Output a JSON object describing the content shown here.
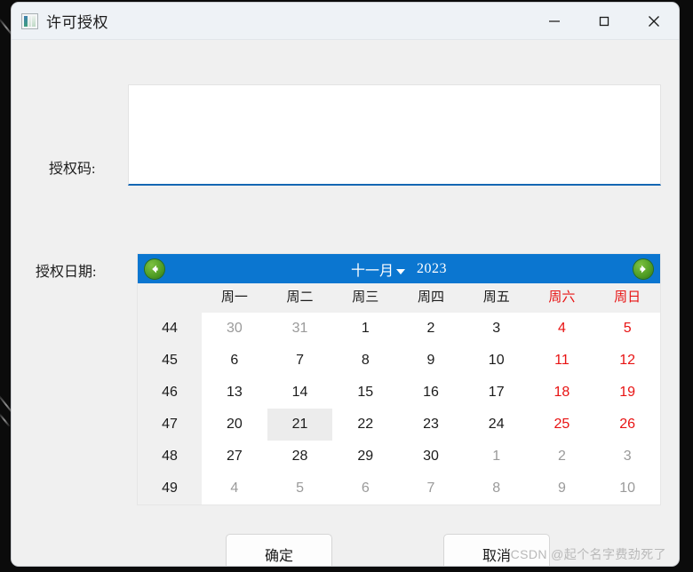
{
  "window": {
    "title": "许可授权",
    "icon": "app-image-icon",
    "controls": [
      {
        "name": "minimize-button",
        "glyph": "minimize-icon"
      },
      {
        "name": "maximize-button",
        "glyph": "maximize-icon"
      },
      {
        "name": "close-button",
        "glyph": "close-icon"
      }
    ]
  },
  "form": {
    "code_label": "授权码:",
    "code_value": "",
    "code_placeholder": "",
    "date_label": "授权日期:"
  },
  "calendar": {
    "prev_icon": "arrow-left-circle-icon",
    "next_icon": "arrow-right-circle-icon",
    "month": "十一月",
    "year": "2023",
    "dropdown_icon": "chevron-down-icon",
    "weekday_header_label": "",
    "weekdays": [
      "周一",
      "周二",
      "周三",
      "周四",
      "周五",
      "周六",
      "周日"
    ],
    "weekend_indices": [
      5,
      6
    ],
    "weekend_color": "#e81313",
    "header_bg": "#0b76d0",
    "selected_day": 21,
    "weeks": [
      {
        "week_number": "44",
        "days": [
          {
            "label": "30",
            "muted": true,
            "weekend": false
          },
          {
            "label": "31",
            "muted": true,
            "weekend": false
          },
          {
            "label": "1",
            "muted": false,
            "weekend": false
          },
          {
            "label": "2",
            "muted": false,
            "weekend": false
          },
          {
            "label": "3",
            "muted": false,
            "weekend": false
          },
          {
            "label": "4",
            "muted": false,
            "weekend": true
          },
          {
            "label": "5",
            "muted": false,
            "weekend": true
          }
        ]
      },
      {
        "week_number": "45",
        "days": [
          {
            "label": "6",
            "muted": false,
            "weekend": false
          },
          {
            "label": "7",
            "muted": false,
            "weekend": false
          },
          {
            "label": "8",
            "muted": false,
            "weekend": false
          },
          {
            "label": "9",
            "muted": false,
            "weekend": false
          },
          {
            "label": "10",
            "muted": false,
            "weekend": false
          },
          {
            "label": "11",
            "muted": false,
            "weekend": true
          },
          {
            "label": "12",
            "muted": false,
            "weekend": true
          }
        ]
      },
      {
        "week_number": "46",
        "days": [
          {
            "label": "13",
            "muted": false,
            "weekend": false
          },
          {
            "label": "14",
            "muted": false,
            "weekend": false
          },
          {
            "label": "15",
            "muted": false,
            "weekend": false
          },
          {
            "label": "16",
            "muted": false,
            "weekend": false
          },
          {
            "label": "17",
            "muted": false,
            "weekend": false
          },
          {
            "label": "18",
            "muted": false,
            "weekend": true
          },
          {
            "label": "19",
            "muted": false,
            "weekend": true
          }
        ]
      },
      {
        "week_number": "47",
        "days": [
          {
            "label": "20",
            "muted": false,
            "weekend": false
          },
          {
            "label": "21",
            "muted": false,
            "weekend": false,
            "today": true
          },
          {
            "label": "22",
            "muted": false,
            "weekend": false
          },
          {
            "label": "23",
            "muted": false,
            "weekend": false
          },
          {
            "label": "24",
            "muted": false,
            "weekend": false
          },
          {
            "label": "25",
            "muted": false,
            "weekend": true
          },
          {
            "label": "26",
            "muted": false,
            "weekend": true
          }
        ]
      },
      {
        "week_number": "48",
        "days": [
          {
            "label": "27",
            "muted": false,
            "weekend": false
          },
          {
            "label": "28",
            "muted": false,
            "weekend": false
          },
          {
            "label": "29",
            "muted": false,
            "weekend": false
          },
          {
            "label": "30",
            "muted": false,
            "weekend": false
          },
          {
            "label": "1",
            "muted": true,
            "weekend": false
          },
          {
            "label": "2",
            "muted": true,
            "weekend": true
          },
          {
            "label": "3",
            "muted": true,
            "weekend": true
          }
        ]
      },
      {
        "week_number": "49",
        "days": [
          {
            "label": "4",
            "muted": true,
            "weekend": false
          },
          {
            "label": "5",
            "muted": true,
            "weekend": false
          },
          {
            "label": "6",
            "muted": true,
            "weekend": false
          },
          {
            "label": "7",
            "muted": true,
            "weekend": false
          },
          {
            "label": "8",
            "muted": true,
            "weekend": false
          },
          {
            "label": "9",
            "muted": true,
            "weekend": true
          },
          {
            "label": "10",
            "muted": true,
            "weekend": true
          }
        ]
      }
    ]
  },
  "footer": {
    "ok_label": "确定",
    "cancel_label": "取消"
  },
  "watermark": "CSDN @起个名字费劲死了"
}
